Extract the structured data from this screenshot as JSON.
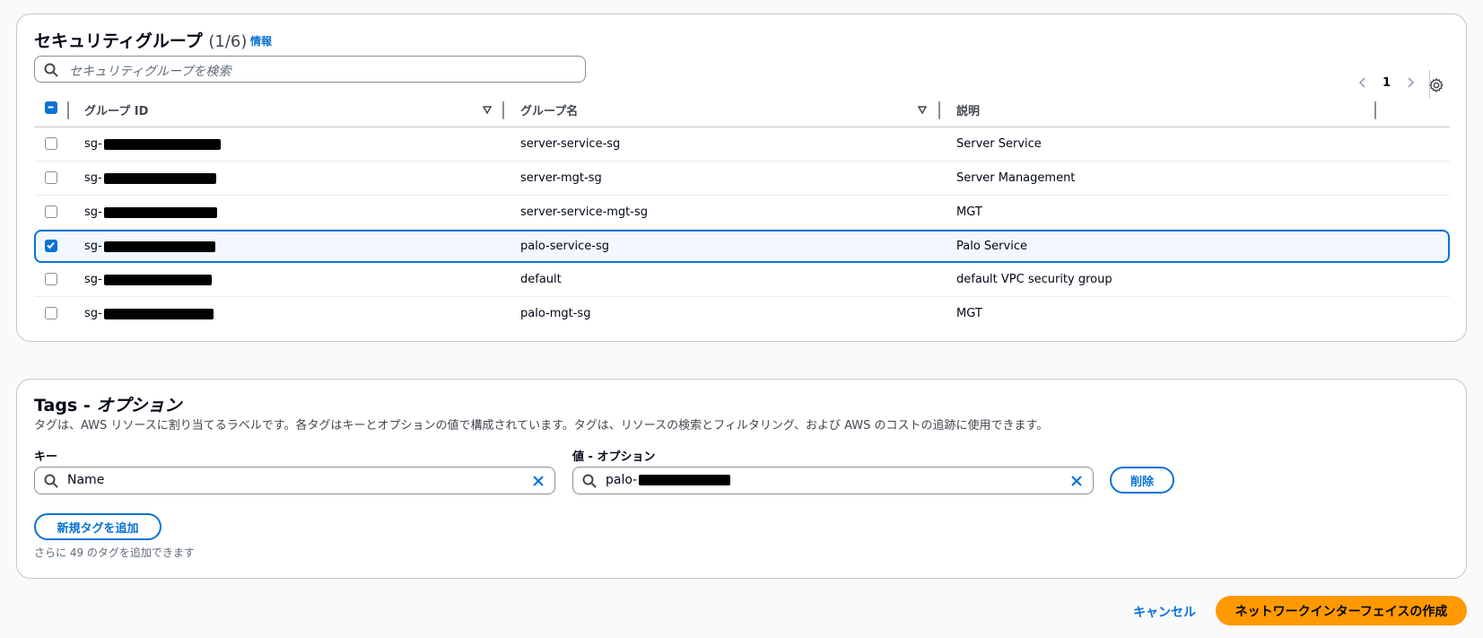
{
  "security_groups": {
    "title": "セキュリティグループ",
    "count": "(1/6)",
    "info_link": "情報",
    "search_placeholder": "セキュリティグループを検索",
    "page_number": "1",
    "columns": {
      "group_id": "グループ ID",
      "group_name": "グループ名",
      "description": "説明"
    },
    "rows": [
      {
        "group_id_prefix": "sg-",
        "group_name": "server-service-sg",
        "description": "Server Service",
        "selected": false
      },
      {
        "group_id_prefix": "sg-",
        "group_name": "server-mgt-sg",
        "description": "Server Management",
        "selected": false
      },
      {
        "group_id_prefix": "sg-",
        "group_name": "server-service-mgt-sg",
        "description": "MGT",
        "selected": false
      },
      {
        "group_id_prefix": "sg-",
        "group_name": "palo-service-sg",
        "description": "Palo Service",
        "selected": true
      },
      {
        "group_id_prefix": "sg-",
        "group_name": "default",
        "description": "default VPC security group",
        "selected": false
      },
      {
        "group_id_prefix": "sg-",
        "group_name": "palo-mgt-sg",
        "description": "MGT",
        "selected": false
      }
    ]
  },
  "tags": {
    "title": "Tags - ",
    "title_optional": "オプション",
    "description": "タグは、AWS リソースに割り当てるラベルです。各タグはキーとオプションの値で構成されています。タグは、リソースの検索とフィルタリング、および AWS のコストの追跡に使用できます。",
    "key_label": "キー",
    "value_label": "値 - オプション",
    "key_value": "Name",
    "value_value_prefix": "palo-",
    "remove_button": "削除",
    "add_button": "新規タグを追加",
    "hint": "さらに 49 のタグを追加できます"
  },
  "footer": {
    "cancel": "キャンセル",
    "create": "ネットワークインターフェイスの作成"
  },
  "colors": {
    "accent": "#0972d3",
    "primary_button": "#ff9900",
    "selected_row_bg": "#f2f8fd"
  }
}
